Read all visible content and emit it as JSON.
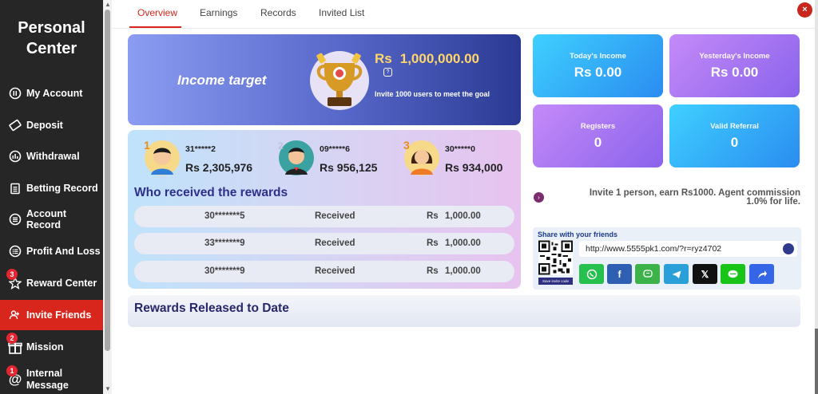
{
  "sidebar": {
    "title_line1": "Personal",
    "title_line2": "Center",
    "items": [
      {
        "label": "My Account",
        "icon": "account-icon"
      },
      {
        "label": "Deposit",
        "icon": "deposit-icon"
      },
      {
        "label": "Withdrawal",
        "icon": "withdrawal-icon"
      },
      {
        "label": "Betting Record",
        "icon": "clipboard-icon"
      },
      {
        "label": "Account Record",
        "icon": "list-icon"
      },
      {
        "label": "Profit And Loss",
        "icon": "list-icon"
      },
      {
        "label": "Reward Center",
        "icon": "star-icon",
        "badge": "3"
      },
      {
        "label": "Invite Friends",
        "icon": "users-icon",
        "active": true
      },
      {
        "label": "Mission",
        "icon": "gift-icon",
        "badge": "2"
      },
      {
        "label": "Internal Message",
        "icon": "mail-icon",
        "badge": "1"
      }
    ]
  },
  "tabs": [
    "Overview",
    "Earnings",
    "Records",
    "Invited List"
  ],
  "active_tab": "Overview",
  "close_label": "×",
  "income_target": {
    "title": "Income target",
    "currency": "Rs",
    "amount": "1,000,000.00",
    "subtitle": "Invite 1000 users to meet the goal"
  },
  "stats": {
    "today": {
      "label": "Today's Income",
      "value": "Rs  0.00"
    },
    "yesterday": {
      "label": "Yesterday's Income",
      "value": "Rs  0.00"
    },
    "registers": {
      "label": "Registers",
      "value": "0"
    },
    "valid_referral": {
      "label": "Valid Referral",
      "value": "0"
    }
  },
  "top_winners": [
    {
      "user": "31*****2",
      "amount": "Rs 2,305,976",
      "rank": "1"
    },
    {
      "user": "09*****6",
      "amount": "Rs 956,125",
      "rank": "2"
    },
    {
      "user": "30*****0",
      "amount": "Rs 934,000",
      "rank": "3"
    }
  ],
  "rewards": {
    "title": "Who received the rewards",
    "rows": [
      {
        "user": "30*******5",
        "status": "Received",
        "currency": "Rs",
        "amount": "1,000.00"
      },
      {
        "user": "33*******9",
        "status": "Received",
        "currency": "Rs",
        "amount": "1,000.00"
      },
      {
        "user": "30*******9",
        "status": "Received",
        "currency": "Rs",
        "amount": "1,000.00"
      }
    ]
  },
  "invite": {
    "line1": "Invite 1 person, earn Rs1000. Agent commission",
    "line2": "1.0% for life."
  },
  "share": {
    "title": "Share with your friends",
    "url": "http://www.5555pk1.com/?r=ryz4702",
    "qr_caption": "Save invite code",
    "buttons": [
      {
        "name": "whatsapp-icon",
        "color": "#25c04e"
      },
      {
        "name": "facebook-icon",
        "color": "#2f5fb3",
        "glyph": "f"
      },
      {
        "name": "sms-icon",
        "color": "#3db24a"
      },
      {
        "name": "telegram-icon",
        "color": "#2a9fd8"
      },
      {
        "name": "x-icon",
        "color": "#111111",
        "glyph": "𝕏"
      },
      {
        "name": "line-icon",
        "color": "#19c419"
      },
      {
        "name": "share-icon",
        "color": "#3566e8"
      }
    ]
  },
  "released": {
    "title": "Rewards Released to Date"
  },
  "colors": {
    "accent": "#d9261c",
    "sidebar_bg": "#262626",
    "navy": "#26286b"
  }
}
